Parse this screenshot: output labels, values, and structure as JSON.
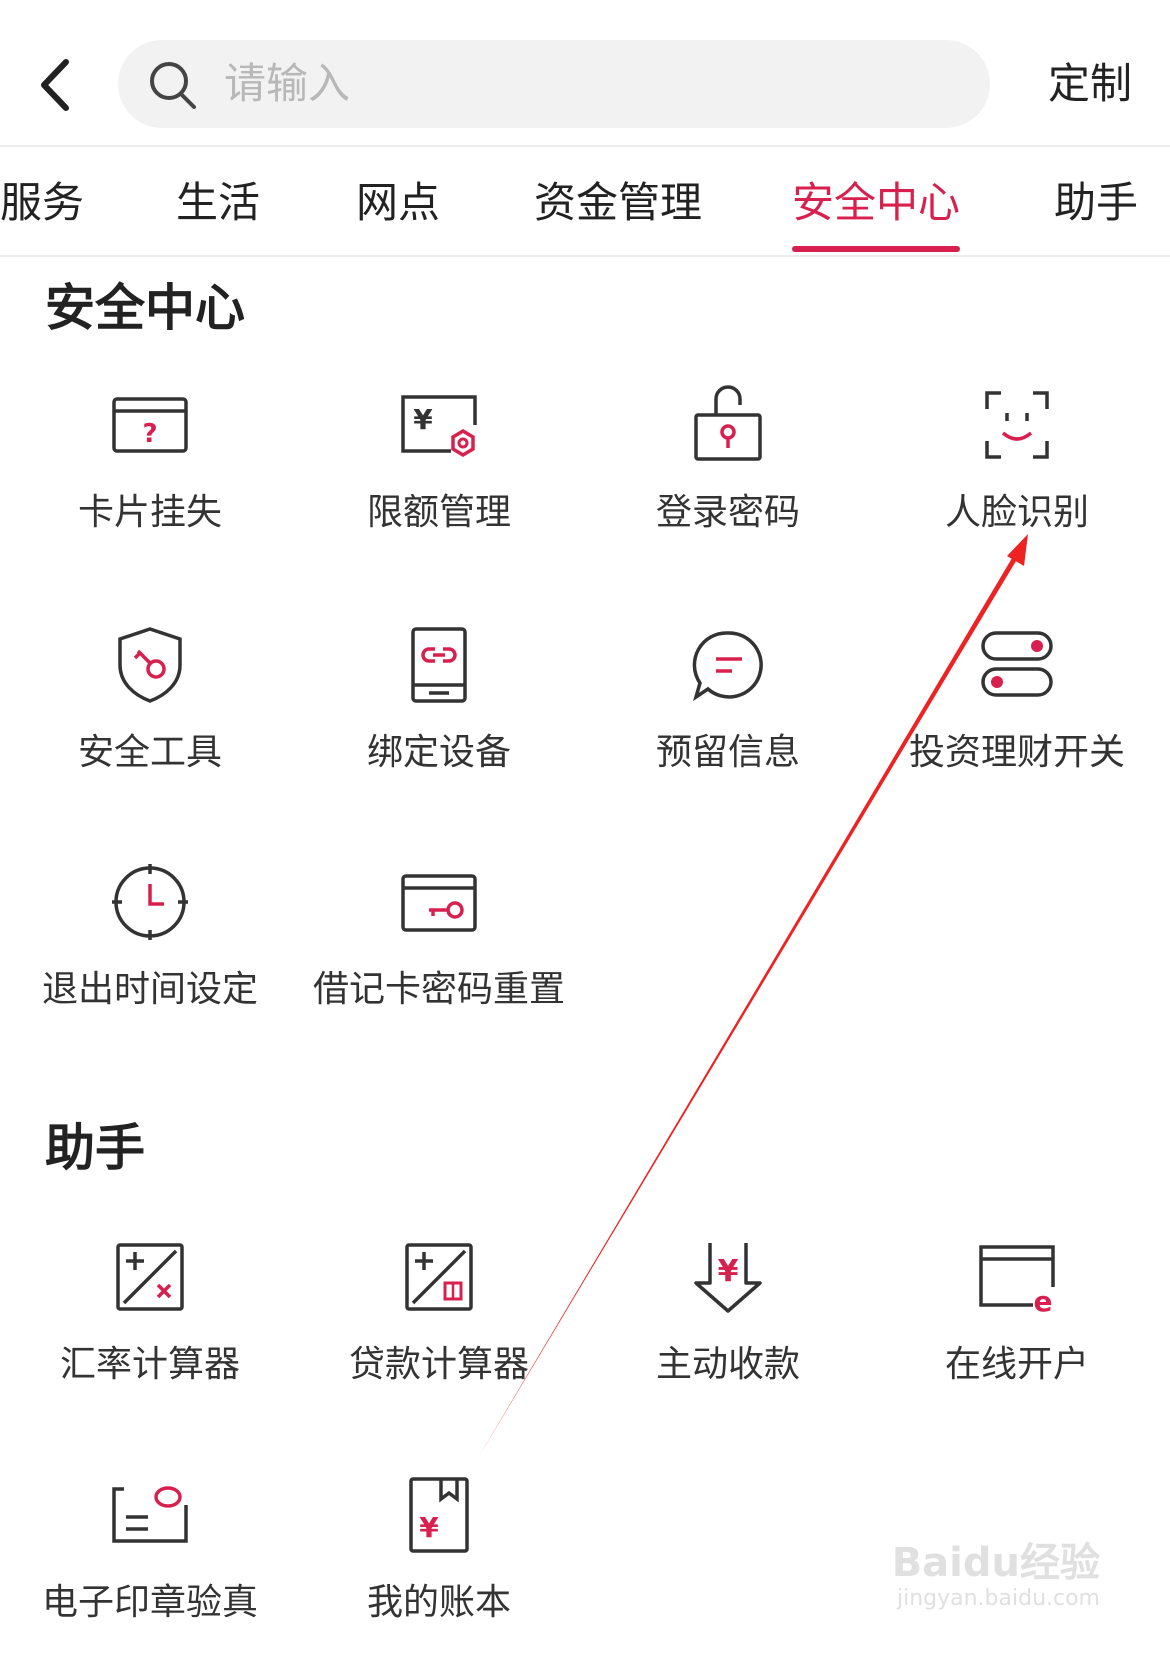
{
  "header": {
    "search_placeholder": "请输入",
    "customize_label": "定制"
  },
  "tabs": [
    {
      "label": "服务"
    },
    {
      "label": "生活"
    },
    {
      "label": "网点"
    },
    {
      "label": "资金管理"
    },
    {
      "label": "安全中心",
      "active": true
    },
    {
      "label": "助手"
    }
  ],
  "sections": {
    "security": {
      "title": "安全中心",
      "items": [
        {
          "label": "卡片挂失",
          "icon": "card-question-icon"
        },
        {
          "label": "限额管理",
          "icon": "limit-yen-icon"
        },
        {
          "label": "登录密码",
          "icon": "unlock-icon"
        },
        {
          "label": "人脸识别",
          "icon": "face-scan-icon"
        },
        {
          "label": "安全工具",
          "icon": "shield-key-icon"
        },
        {
          "label": "绑定设备",
          "icon": "device-link-icon"
        },
        {
          "label": "预留信息",
          "icon": "message-icon"
        },
        {
          "label": "投资理财开关",
          "icon": "toggle-icon"
        },
        {
          "label": "退出时间设定",
          "icon": "clock-icon"
        },
        {
          "label": "借记卡密码重置",
          "icon": "card-key-icon"
        }
      ]
    },
    "assistant": {
      "title": "助手",
      "items": [
        {
          "label": "汇率计算器",
          "icon": "exchange-calculator-icon"
        },
        {
          "label": "贷款计算器",
          "icon": "loan-calculator-icon"
        },
        {
          "label": "主动收款",
          "icon": "receive-payment-icon"
        },
        {
          "label": "在线开户",
          "icon": "online-account-icon"
        },
        {
          "label": "电子印章验真",
          "icon": "e-seal-icon"
        },
        {
          "label": "我的账本",
          "icon": "ledger-icon"
        }
      ]
    }
  },
  "watermark": {
    "main": "Baidu经验",
    "sub": "jingyan.baidu.com"
  },
  "colors": {
    "accent": "#d8204f",
    "icon_stroke": "#333333",
    "annotation": "#ee2222"
  }
}
